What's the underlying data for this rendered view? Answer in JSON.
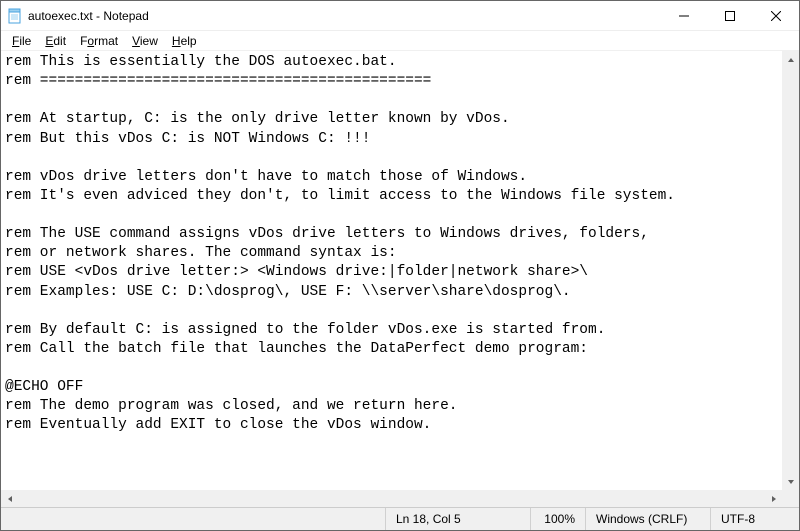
{
  "titlebar": {
    "title": "autoexec.txt - Notepad"
  },
  "menu": {
    "file": "File",
    "edit": "Edit",
    "format": "Format",
    "view": "View",
    "help": "Help"
  },
  "text": "rem This is essentially the DOS autoexec.bat.\nrem =============================================\n\nrem At startup, C: is the only drive letter known by vDos.\nrem But this vDos C: is NOT Windows C: !!!\n\nrem vDos drive letters don't have to match those of Windows.\nrem It's even adviced they don't, to limit access to the Windows file system.\n\nrem The USE command assigns vDos drive letters to Windows drives, folders,\nrem or network shares. The command syntax is:\nrem USE <vDos drive letter:> <Windows drive:|folder|network share>\\\nrem Examples: USE C: D:\\dosprog\\, USE F: \\\\server\\share\\dosprog\\.\n\nrem By default C: is assigned to the folder vDos.exe is started from.\nrem Call the batch file that launches the DataPerfect demo program:\n\n@ECHO OFF\nrem The demo program was closed, and we return here.\nrem Eventually add EXIT to close the vDos window.",
  "status": {
    "position": "Ln 18, Col 5",
    "zoom": "100%",
    "line_ending": "Windows (CRLF)",
    "encoding": "UTF-8"
  }
}
